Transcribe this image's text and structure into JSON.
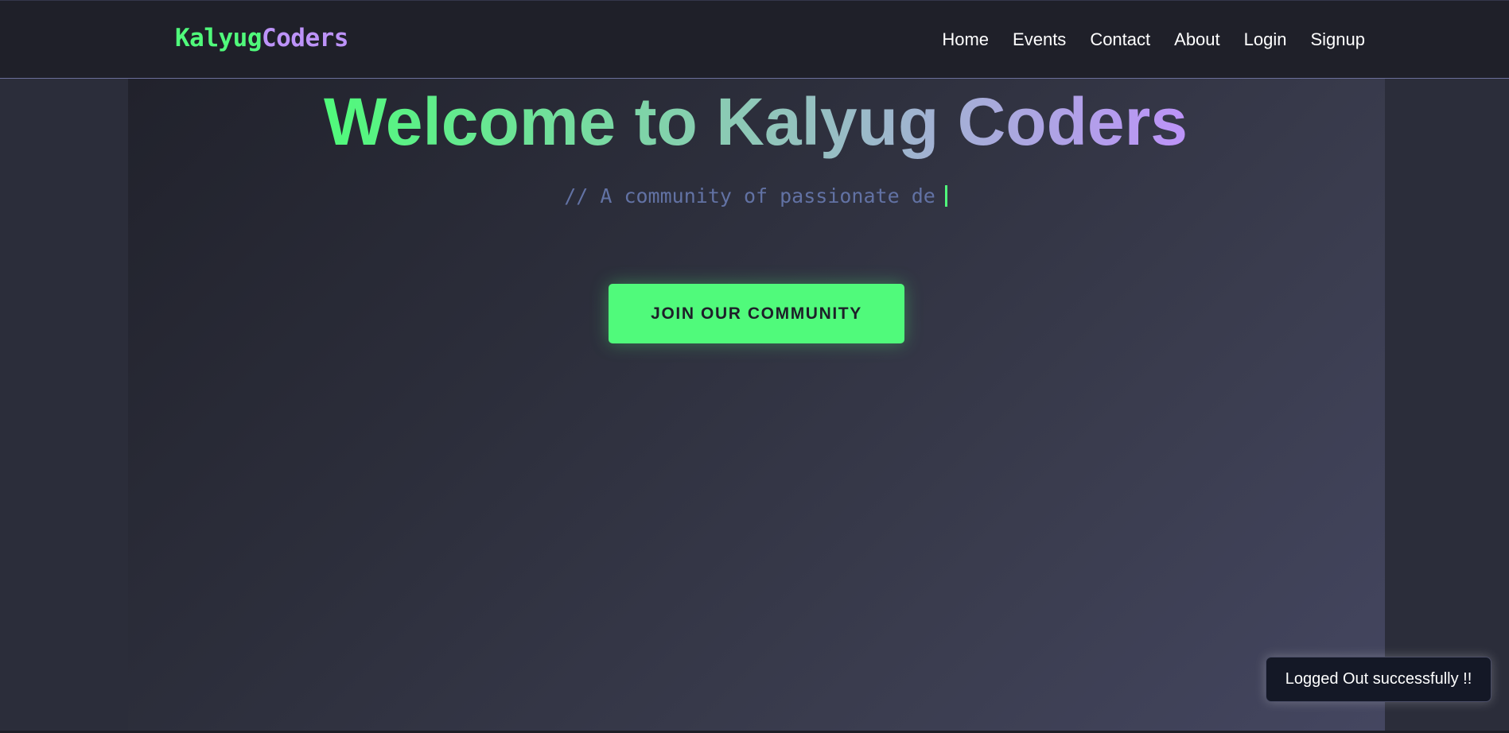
{
  "navbar": {
    "logo_part1": "Kalyug",
    "logo_part2": "Coders",
    "links": [
      "Home",
      "Events",
      "Contact",
      "About",
      "Login",
      "Signup"
    ]
  },
  "hero": {
    "title": "Welcome to Kalyug Coders",
    "tagline": "// A community of passionate de",
    "cta_label": "JOIN OUR COMMUNITY"
  },
  "toast": {
    "message": "Logged Out successfully !!"
  },
  "colors": {
    "accent_green": "#50fa7b",
    "accent_purple": "#bd93f9",
    "comment_blue": "#6272a4",
    "nav_bg": "#1f2029"
  }
}
